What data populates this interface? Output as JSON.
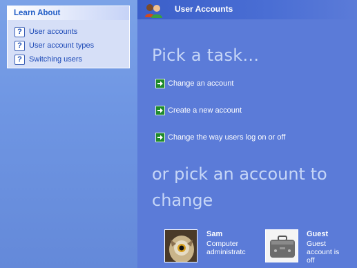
{
  "learn_about": {
    "title": "Learn About",
    "items": [
      {
        "label": "User accounts",
        "icon": "help-icon"
      },
      {
        "label": "User account types",
        "icon": "help-icon"
      },
      {
        "label": "Switching users",
        "icon": "help-icon"
      }
    ]
  },
  "header": {
    "title": "User Accounts",
    "icon": "user-accounts-icon"
  },
  "main": {
    "pick_task": "Pick a task...",
    "tasks": [
      {
        "label": "Change an account",
        "icon": "green-arrow-icon"
      },
      {
        "label": "Create a new account",
        "icon": "green-arrow-icon"
      },
      {
        "label": "Change the way users log on or off",
        "icon": "green-arrow-icon"
      }
    ],
    "pick_account": "or pick an account to change",
    "accounts": [
      {
        "name": "Sam",
        "desc_1": "Computer",
        "desc_2": "administratc",
        "picture": "owl-picture"
      },
      {
        "name": "Guest",
        "desc_1": "Guest",
        "desc_2": "account is",
        "desc_3": "off",
        "picture": "suitcase-picture"
      }
    ]
  },
  "colors": {
    "accent_green": "#1f8a2c",
    "panel_blue": "#5b7bd8",
    "heading_text": "#c6d6f7"
  }
}
